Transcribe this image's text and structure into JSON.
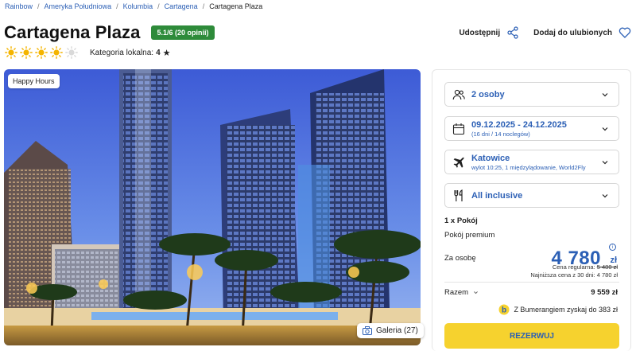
{
  "breadcrumbs": [
    {
      "label": "Rainbow"
    },
    {
      "label": "Ameryka Południowa"
    },
    {
      "label": "Kolumbia"
    },
    {
      "label": "Cartagena"
    },
    {
      "label": "Cartagena Plaza"
    }
  ],
  "hotel": {
    "title": "Cartagena Plaza",
    "rating_badge": "5.1/6 (20 opinii)",
    "stars_total": 5,
    "stars_filled": 4,
    "local_category_label": "Kategoria lokalna:",
    "local_category_value": "4"
  },
  "actions": {
    "share_label": "Udostępnij",
    "favorite_label": "Dodaj do ulubionych"
  },
  "photo": {
    "badge": "Happy Hours",
    "gallery_label": "Galeria (27)"
  },
  "booking": {
    "persons": "2 osoby",
    "dates": "09.12.2025 - 24.12.2025",
    "dates_sub": "(16 dni / 14 noclegów)",
    "departure": "Katowice",
    "departure_sub": "wylot 10:25, 1 międzylądowanie, World2Fly",
    "board": "All inclusive",
    "rooms_count": "1 x Pokój",
    "room_type": "Pokój premium",
    "per_person_label": "Za osobę",
    "price": "4 780",
    "currency": "zł",
    "regular_price_label": "Cena regularna:",
    "regular_price": "5 480 zł",
    "lowest_price_text": "Najniższa cena z 30 dni: 4 780 zł",
    "total_label": "Razem",
    "total_value": "9 559 zł",
    "bumerang_text": "Z Bumerangiem zyskaj do 383 zł",
    "book_button": "REZERWUJ"
  },
  "colors": {
    "accent_blue": "#2b5fb5",
    "badge_green": "#2e8b3a",
    "button_yellow": "#f6d22e",
    "star_filled": "#f4b400",
    "star_empty": "#d9d9d9"
  }
}
